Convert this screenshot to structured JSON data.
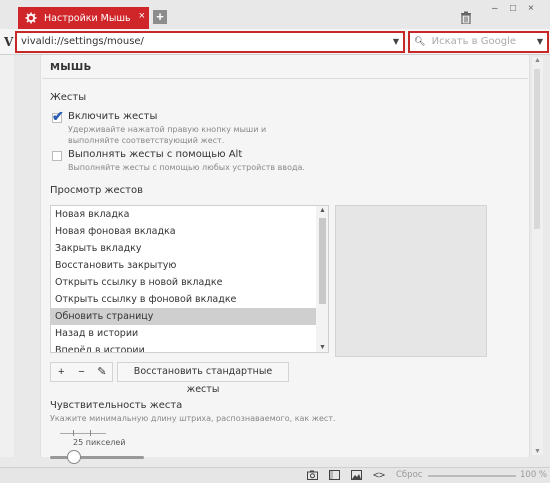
{
  "tab": {
    "title": "Настройки Мышь",
    "icon": "gear-icon"
  },
  "address": {
    "url": "vivaldi://settings/mouse/",
    "search_placeholder": "Искать в Google"
  },
  "page": {
    "title": "МЫШЬ",
    "gestures_header": "Жесты",
    "enable_gestures": {
      "label": "Включить жесты",
      "checked": true,
      "hint": "Удерживайте нажатой правую кнопку мыши и выполняйте соответствующий жест."
    },
    "alt_gestures": {
      "label": "Выполнять жесты с помощью Alt",
      "checked": false,
      "hint": "Выполняйте жесты с помощью любых устройств ввода."
    },
    "view_header": "Просмотр жестов",
    "gesture_list": [
      "Новая вкладка",
      "Новая фоновая вкладка",
      "Закрыть вкладку",
      "Восстановить закрытую",
      "Открыть ссылку в новой вкладке",
      "Открыть ссылку в фоновой вкладке",
      "Обновить страницу",
      "Назад в истории",
      "Вперёд в истории"
    ],
    "selected_index": 6,
    "tools": {
      "add": "+",
      "remove": "−",
      "edit": "✎"
    },
    "restore_button": "Восстановить стандартные жесты",
    "sensitivity_header": "Чувствительность жеста",
    "sensitivity_hint": "Укажите минимальную длину штриха, распознаваемого, как жест.",
    "sensitivity_value_label": "25 пикселей",
    "sensitivity_level": 0.25
  },
  "status": {
    "reset_label": "Сброс",
    "zoom": "100 %"
  },
  "colors": {
    "accent": "#d0262a",
    "check": "#2a5db0"
  }
}
